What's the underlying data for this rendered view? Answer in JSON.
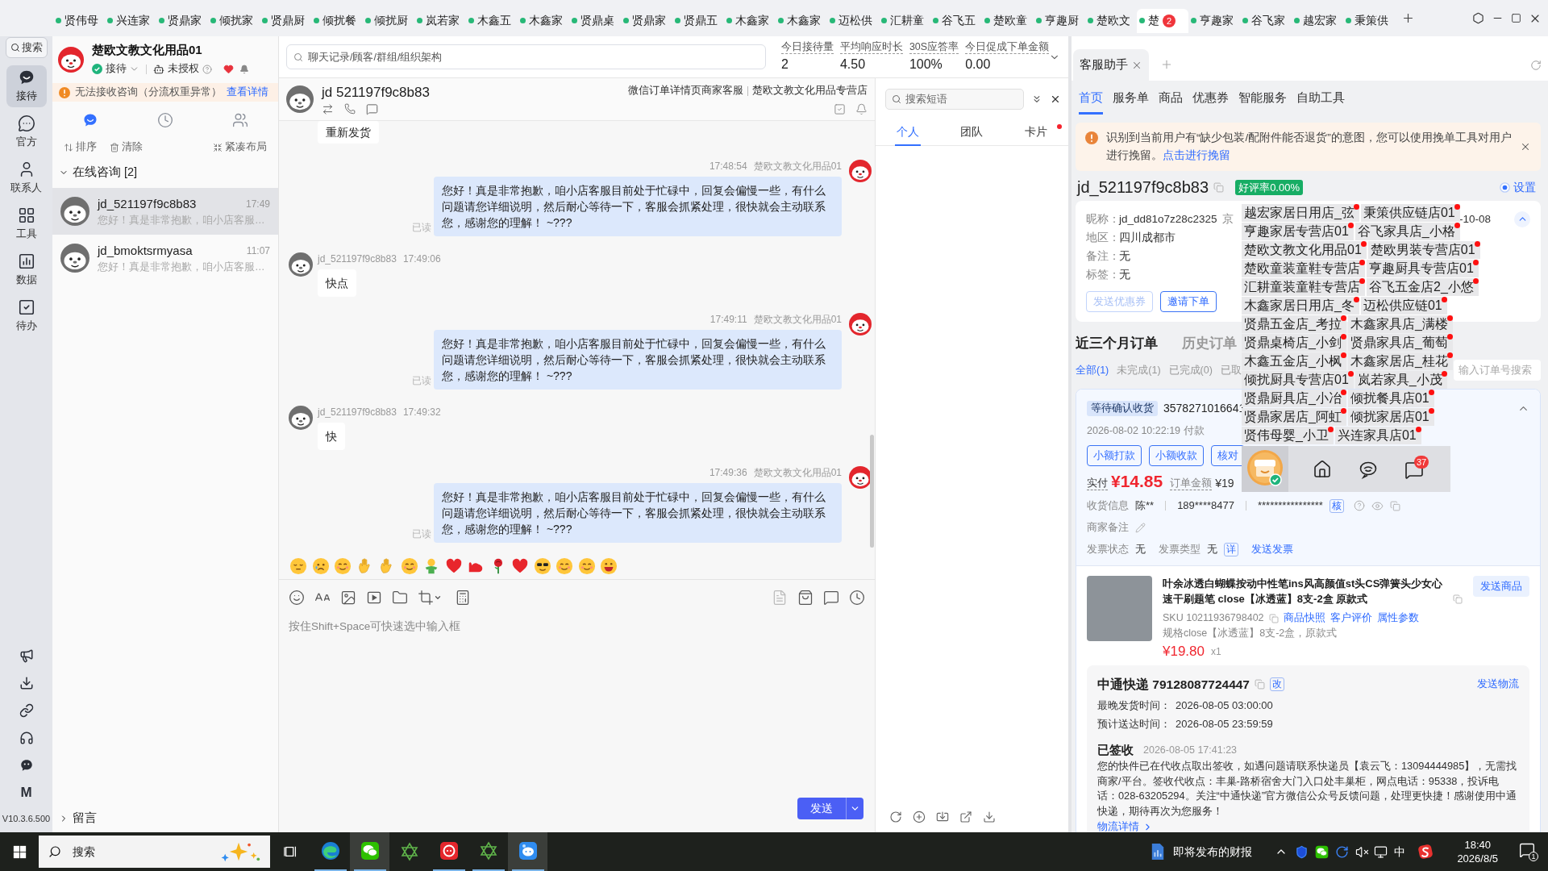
{
  "window_tabs": [
    {
      "label": "贤伟母",
      "selected": false
    },
    {
      "label": "兴连家",
      "selected": false
    },
    {
      "label": "贤鼎家",
      "selected": false
    },
    {
      "label": "倾扰家",
      "selected": false
    },
    {
      "label": "贤鼎厨",
      "selected": false
    },
    {
      "label": "倾扰餐",
      "selected": false
    },
    {
      "label": "倾扰厨",
      "selected": false
    },
    {
      "label": "岚若家",
      "selected": false
    },
    {
      "label": "木鑫五",
      "selected": false
    },
    {
      "label": "木鑫家",
      "selected": false
    },
    {
      "label": "贤鼎桌",
      "selected": false
    },
    {
      "label": "贤鼎家",
      "selected": false
    },
    {
      "label": "贤鼎五",
      "selected": false
    },
    {
      "label": "木鑫家",
      "selected": false
    },
    {
      "label": "木鑫家",
      "selected": false
    },
    {
      "label": "迈松供",
      "selected": false
    },
    {
      "label": "汇耕童",
      "selected": false
    },
    {
      "label": "谷飞五",
      "selected": false
    },
    {
      "label": "楚欧童",
      "selected": false
    },
    {
      "label": "亨趣厨",
      "selected": false
    },
    {
      "label": "楚欧文",
      "selected": false
    },
    {
      "label": "楚",
      "selected": true,
      "badge": "2"
    },
    {
      "label": "亨趣家",
      "selected": false
    },
    {
      "label": "谷飞家",
      "selected": false
    },
    {
      "label": "越宏家",
      "selected": false
    },
    {
      "label": "秉策供",
      "selected": false
    }
  ],
  "nav_rail": {
    "search": "搜索",
    "items": [
      {
        "label": "接待",
        "selected": true
      },
      {
        "label": "官方",
        "selected": false
      },
      {
        "label": "联系人",
        "selected": false
      },
      {
        "label": "工具",
        "selected": false
      },
      {
        "label": "数据",
        "selected": false
      },
      {
        "label": "待办",
        "selected": false
      }
    ],
    "letter_icon": "M",
    "version": "V10.3.6.500"
  },
  "account": {
    "name": "楚欧文教文化用品01",
    "online": true,
    "status": "接待",
    "authorization": "未授权"
  },
  "warning": {
    "text": "无法接收咨询（分流权重异常）",
    "link": "查看详情"
  },
  "list_tabs": [
    {
      "selected": true
    },
    {
      "selected": false
    },
    {
      "selected": false
    }
  ],
  "list_actions": [
    "排序",
    "清除",
    "紧凑布局"
  ],
  "group": {
    "label": "在线咨询 [2]",
    "expanded": true
  },
  "conversations": [
    {
      "name": "jd_521197f9c8b83",
      "time": "17:49",
      "preview": "您好！真是非常抱歉，咱小店客服…",
      "selected": true
    },
    {
      "name": "jd_bmoktsrmyasa",
      "time": "11:07",
      "preview": "您好！真是非常抱歉，咱小店客服…",
      "selected": false
    }
  ],
  "footer_group": {
    "label": "留言",
    "expanded": false
  },
  "search": {
    "placeholder": "聊天记录/顾客/群组/组织架构"
  },
  "stats": [
    {
      "label": "今日接待量",
      "value": "2"
    },
    {
      "label": "平均响应时长",
      "value": "4.50"
    },
    {
      "label": "30S应答率",
      "value": "100%"
    },
    {
      "label": "今日促成下单金额",
      "value": "0.00"
    }
  ],
  "chat": {
    "title": "jd 521197f9c8b83",
    "source": "微信订单详情页商家客服",
    "shop": "楚欧文教文化用品专营店",
    "messages": [
      {
        "kind": "customer",
        "text": "重新发货"
      },
      {
        "kind": "shop",
        "time": "17:48:54",
        "sender": "楚欧文教文化用品01",
        "text": "您好！真是非常抱歉，咱小店客服目前处于忙碌中，回复会偏慢一些，有什么问题请您详细说明，然后耐心等待一下，客服会抓紧处理，很快就会主动联系您，感谢您的理解！ ~???",
        "receipt": "已读"
      },
      {
        "kind": "customer",
        "sender": "jd_521197f9c8b83",
        "time": "17:49:06",
        "text": "快点"
      },
      {
        "kind": "shop",
        "time": "17:49:11",
        "sender": "楚欧文教文化用品01",
        "text": "您好！真是非常抱歉，咱小店客服目前处于忙碌中，回复会偏慢一些，有什么问题请您详细说明，然后耐心等待一下，客服会抓紧处理，很快就会主动联系您，感谢您的理解！ ~???",
        "receipt": "已读"
      },
      {
        "kind": "customer",
        "sender": "jd_521197f9c8b83",
        "time": "17:49:32",
        "text": "快"
      },
      {
        "kind": "shop",
        "time": "17:49:36",
        "sender": "楚欧文教文化用品01",
        "text": "您好！真是非常抱歉，咱小店客服目前处于忙碌中，回复会偏慢一些，有什么问题请您详细说明，然后耐心等待一下，客服会抓紧处理，很快就会主动联系您，感谢您的理解！ ~???",
        "receipt": "已读"
      }
    ]
  },
  "composer": {
    "placeholder": "按住Shift+Space可快速选中输入框",
    "send": "发送"
  },
  "phrases": {
    "placeholder": "搜索短语",
    "tabs": [
      {
        "label": "个人",
        "selected": true,
        "dot": false
      },
      {
        "label": "团队",
        "selected": false,
        "dot": false
      },
      {
        "label": "卡片",
        "selected": false,
        "dot": true
      }
    ]
  },
  "assistant": {
    "tab": "客服助手",
    "nav": [
      {
        "label": "首页",
        "selected": true
      },
      {
        "label": "服务单",
        "selected": false
      },
      {
        "label": "商品",
        "selected": false
      },
      {
        "label": "优惠券",
        "selected": false
      },
      {
        "label": "智能服务",
        "selected": false
      },
      {
        "label": "自助工具",
        "selected": false
      }
    ],
    "alert": {
      "text": "识别到当前用户有“缺少包装/配附件能否退货”的意图，您可以使用挽单工具对用户进行挽留。",
      "link": "点击进行挽留"
    },
    "customer": {
      "name": "jd_521197f9c8b83",
      "rating": "好评率0.00%",
      "settings": {
        "label": "设置",
        "on": true
      }
    },
    "info": [
      {
        "label": "昵称：",
        "value": "jd_dd81o7z28c2325"
      },
      {
        "label": "地区：",
        "value": "四川成都市"
      },
      {
        "label": "备注：",
        "value": "无"
      },
      {
        "label": "标签：",
        "value": "无"
      }
    ],
    "info_side": {
      "label": "京",
      "value": "-10-08"
    },
    "actions": [
      {
        "label": "发送优惠券",
        "disabled": true
      },
      {
        "label": "邀请下单",
        "disabled": false
      }
    ],
    "order_tabs": [
      {
        "label": "近三个月订单",
        "selected": true
      },
      {
        "label": "历史订单",
        "selected": false
      }
    ],
    "filters": [
      {
        "label": "全部(1)",
        "selected": true
      },
      {
        "label": "未完成(1)",
        "selected": false
      },
      {
        "label": "已完成(0)",
        "selected": false
      },
      {
        "label": "已取",
        "selected": false
      }
    ],
    "order_search": {
      "placeholder": "输入订单号搜索"
    },
    "order": {
      "status": "等待确认收货",
      "number": "3578271016641",
      "paid_time": "2026-08-02 10:22:19 付款",
      "buttons": [
        "小额打款",
        "小额收款",
        "核对"
      ],
      "paid_label": "实付",
      "paid": "¥14.85",
      "total_label": "订单金额",
      "total": "¥19",
      "address_label": "收货信息",
      "receiver": "陈**",
      "phone": "189****8477",
      "address": "****************",
      "verify": "核",
      "remark_label": "商家备注",
      "invoice": [
        {
          "label": "发票状态",
          "value": "无"
        },
        {
          "label": "发票类型",
          "value": "无"
        }
      ],
      "invoice_detail": "详",
      "invoice_send": "发送发票",
      "product": {
        "title": "叶余冰透白蝴蝶按动中性笔ins风高颜值st头CS弹簧头少女心速干刷题笔 close【冰透蓝】8支-2盒 原款式",
        "send": "发送商品",
        "sku": "SKU 10211936798402",
        "links": [
          "商品快照",
          "客户评价",
          "属性参数"
        ],
        "spec": "规格close【冰透蓝】8支-2盒，原款式",
        "price": "¥19.80",
        "qty": "x1"
      },
      "shipping": {
        "carrier": "中通快递 79128087724447",
        "edit": "改",
        "send": "发送物流",
        "rows": [
          {
            "label": "最晚发货时间：",
            "value": "2026-08-05 03:00:00"
          },
          {
            "label": "预计送达时间：",
            "value": "2026-08-05 23:59:59"
          }
        ],
        "status": "已签收",
        "status_time": "2026-08-05 17:41:23",
        "detail": "您的快件已在代收点取出签收，如遇问题请联系快递员【袁云飞：13094444985】，无需找商家/平台。签收代收点：丰巢-路桥宿舍大门入口处丰巢柜，网点电话：95338，投诉电话：028-63205294。关注“中通快递”官方微信公众号反馈问题，处理更快捷！感谢使用中通快递，期待再次为您服务！",
        "link": "物流详情"
      }
    }
  },
  "shop_switcher": {
    "shops": [
      {
        "name": "越宏家居日用店_弦",
        "unread": true
      },
      {
        "name": "秉策供应链店01",
        "unread": true
      },
      {
        "name": "亨趣家居专营店01",
        "unread": true
      },
      {
        "name": "谷飞家具店_小格",
        "unread": true
      },
      {
        "name": "楚欧文教文化用品01",
        "unread": true
      },
      {
        "name": "楚欧男装专营店01",
        "unread": true
      },
      {
        "name": "楚欧童装童鞋专营店",
        "unread": true
      },
      {
        "name": "亨趣厨具专营店01",
        "unread": true
      },
      {
        "name": "汇耕童装童鞋专营店",
        "unread": true
      },
      {
        "name": "谷飞五金店2_小悠",
        "unread": true
      },
      {
        "name": "木鑫家居日用店_冬",
        "unread": true
      },
      {
        "name": "迈松供应链01",
        "unread": true
      },
      {
        "name": "贤鼎五金店_考拉",
        "unread": true
      },
      {
        "name": "木鑫家具店_满楼",
        "unread": true
      },
      {
        "name": "贤鼎桌椅店_小剑",
        "unread": true
      },
      {
        "name": "贤鼎家具店_葡萄",
        "unread": true
      },
      {
        "name": "木鑫五金店_小枫",
        "unread": true
      },
      {
        "name": "木鑫家居店_桂花",
        "unread": true
      },
      {
        "name": "倾扰厨具专营店01",
        "unread": true
      },
      {
        "name": "岚若家具_小茂",
        "unread": true
      },
      {
        "name": "贤鼎厨具店_小冶",
        "unread": true
      },
      {
        "name": "倾扰餐具店01",
        "unread": true
      },
      {
        "name": "贤鼎家居店_阿虹",
        "unread": true
      },
      {
        "name": "倾扰家居店01",
        "unread": true
      },
      {
        "name": "贤伟母婴_小卫",
        "unread": true
      },
      {
        "name": "兴连家具店01",
        "unread": true
      }
    ]
  },
  "float_bar": {
    "verified": true,
    "badge": "37"
  },
  "taskbar": {
    "search": {
      "placeholder": "搜索"
    },
    "apps": [
      {
        "running": true,
        "active": false
      },
      {
        "running": true,
        "active": true
      },
      {
        "running": false,
        "active": false
      },
      {
        "running": true,
        "active": false
      },
      {
        "running": true,
        "active": false
      },
      {
        "running": true,
        "active": true
      }
    ],
    "news": "即将发布的财报",
    "ime": "中",
    "time": "18:40",
    "date": "2026/8/5",
    "notifications": "1"
  }
}
